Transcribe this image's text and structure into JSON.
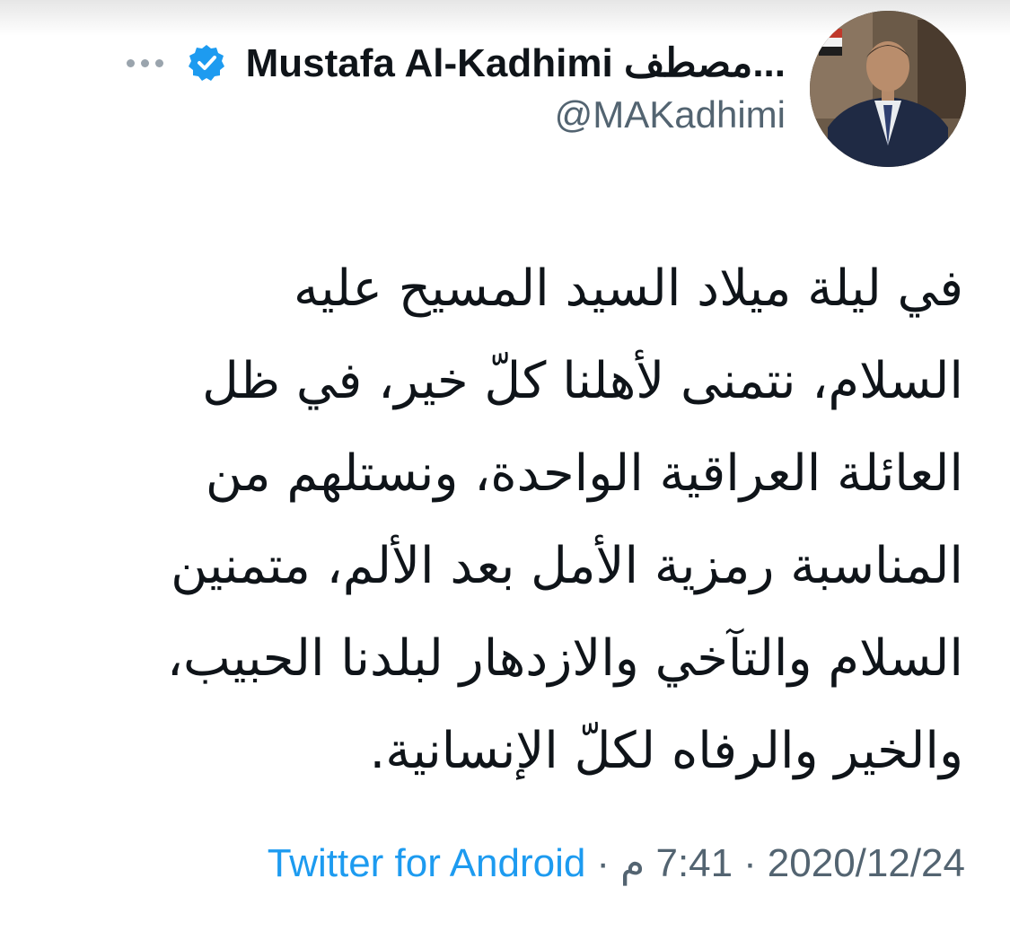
{
  "user": {
    "display_name": "Mustafa Al-Kadhimi مصطف...",
    "handle": "@MAKadhimi",
    "verified_icon": "verified-badge-icon",
    "avatar_icon": "profile-photo",
    "more_icon": "more-options-icon"
  },
  "tweet": {
    "lines": [
      "في ليلة ميلاد السيد المسيح عليه",
      "السلام، نتمنى لأهلنا كلّ خير، في ظل",
      "العائلة العراقية الواحدة، ونستلهم من",
      "المناسبة رمزية الأمل بعد الألم، متمنين",
      "السلام والتآخي والازدهار لبلدنا الحبيب،",
      "والخير والرفاه لكلّ الإنسانية."
    ]
  },
  "meta": {
    "date": "2020/12/24",
    "separator": "·",
    "time": "7:41 م",
    "source": "Twitter for Android"
  },
  "colors": {
    "text": "#0f1419",
    "secondary": "#536471",
    "link": "#1d9bf0",
    "verified": "#1d9bf0"
  }
}
